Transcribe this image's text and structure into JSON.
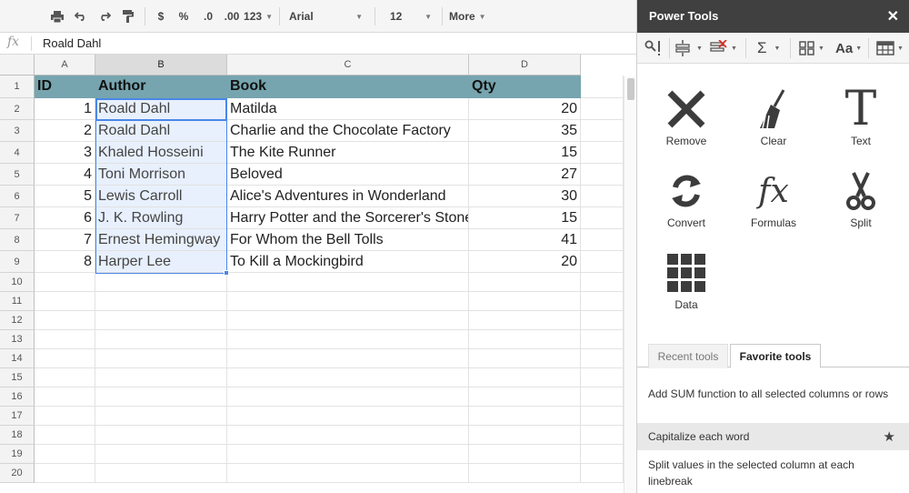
{
  "toolbar": {
    "currency": "$",
    "percent": "%",
    "dec_less": ".0",
    "dec_more": ".00",
    "number_format": "123",
    "font": "Arial",
    "font_size": "12",
    "more": "More"
  },
  "formula_bar": {
    "fx": "fx",
    "value": "Roald Dahl"
  },
  "grid": {
    "columns": [
      "A",
      "B",
      "C",
      "D"
    ],
    "rows": [
      "1",
      "2",
      "3",
      "4",
      "5",
      "6",
      "7",
      "8",
      "9",
      "10",
      "11",
      "12",
      "13",
      "14",
      "15",
      "16",
      "17",
      "18",
      "19",
      "20"
    ],
    "header": [
      "ID",
      "Author",
      "Book",
      "Qty"
    ],
    "data": [
      [
        "1",
        "Roald Dahl",
        "Matilda",
        "20"
      ],
      [
        "2",
        "Roald Dahl",
        "Charlie and the Chocolate Factory",
        "35"
      ],
      [
        "3",
        "Khaled Hosseini",
        "The Kite Runner",
        "15"
      ],
      [
        "4",
        "Toni Morrison",
        "Beloved",
        "27"
      ],
      [
        "5",
        "Lewis Carroll",
        "Alice's Adventures in Wonderland",
        "30"
      ],
      [
        "6",
        "J. K. Rowling",
        "Harry Potter and the Sorcerer's Stone",
        "15"
      ],
      [
        "7",
        "Ernest Hemingway",
        "For Whom the Bell Tolls",
        "41"
      ],
      [
        "8",
        "Harper Lee",
        "To Kill a Mockingbird",
        "20"
      ]
    ]
  },
  "sidebar": {
    "title": "Power Tools",
    "close": "✕",
    "tools": [
      {
        "label": "Remove"
      },
      {
        "label": "Clear"
      },
      {
        "label": "Text"
      },
      {
        "label": "Convert"
      },
      {
        "label": "Formulas"
      },
      {
        "label": "Split"
      },
      {
        "label": "Data"
      }
    ],
    "tabs": {
      "recent": "Recent tools",
      "favorite": "Favorite tools"
    },
    "favorites": [
      "Add SUM function to all selected columns or rows",
      "Capitalize each word",
      "Split values in the selected column at each linebreak"
    ],
    "formulas_glyph": "fx",
    "text_glyph": "T",
    "sum_glyph": "Σ",
    "font_glyph": "Aa"
  }
}
